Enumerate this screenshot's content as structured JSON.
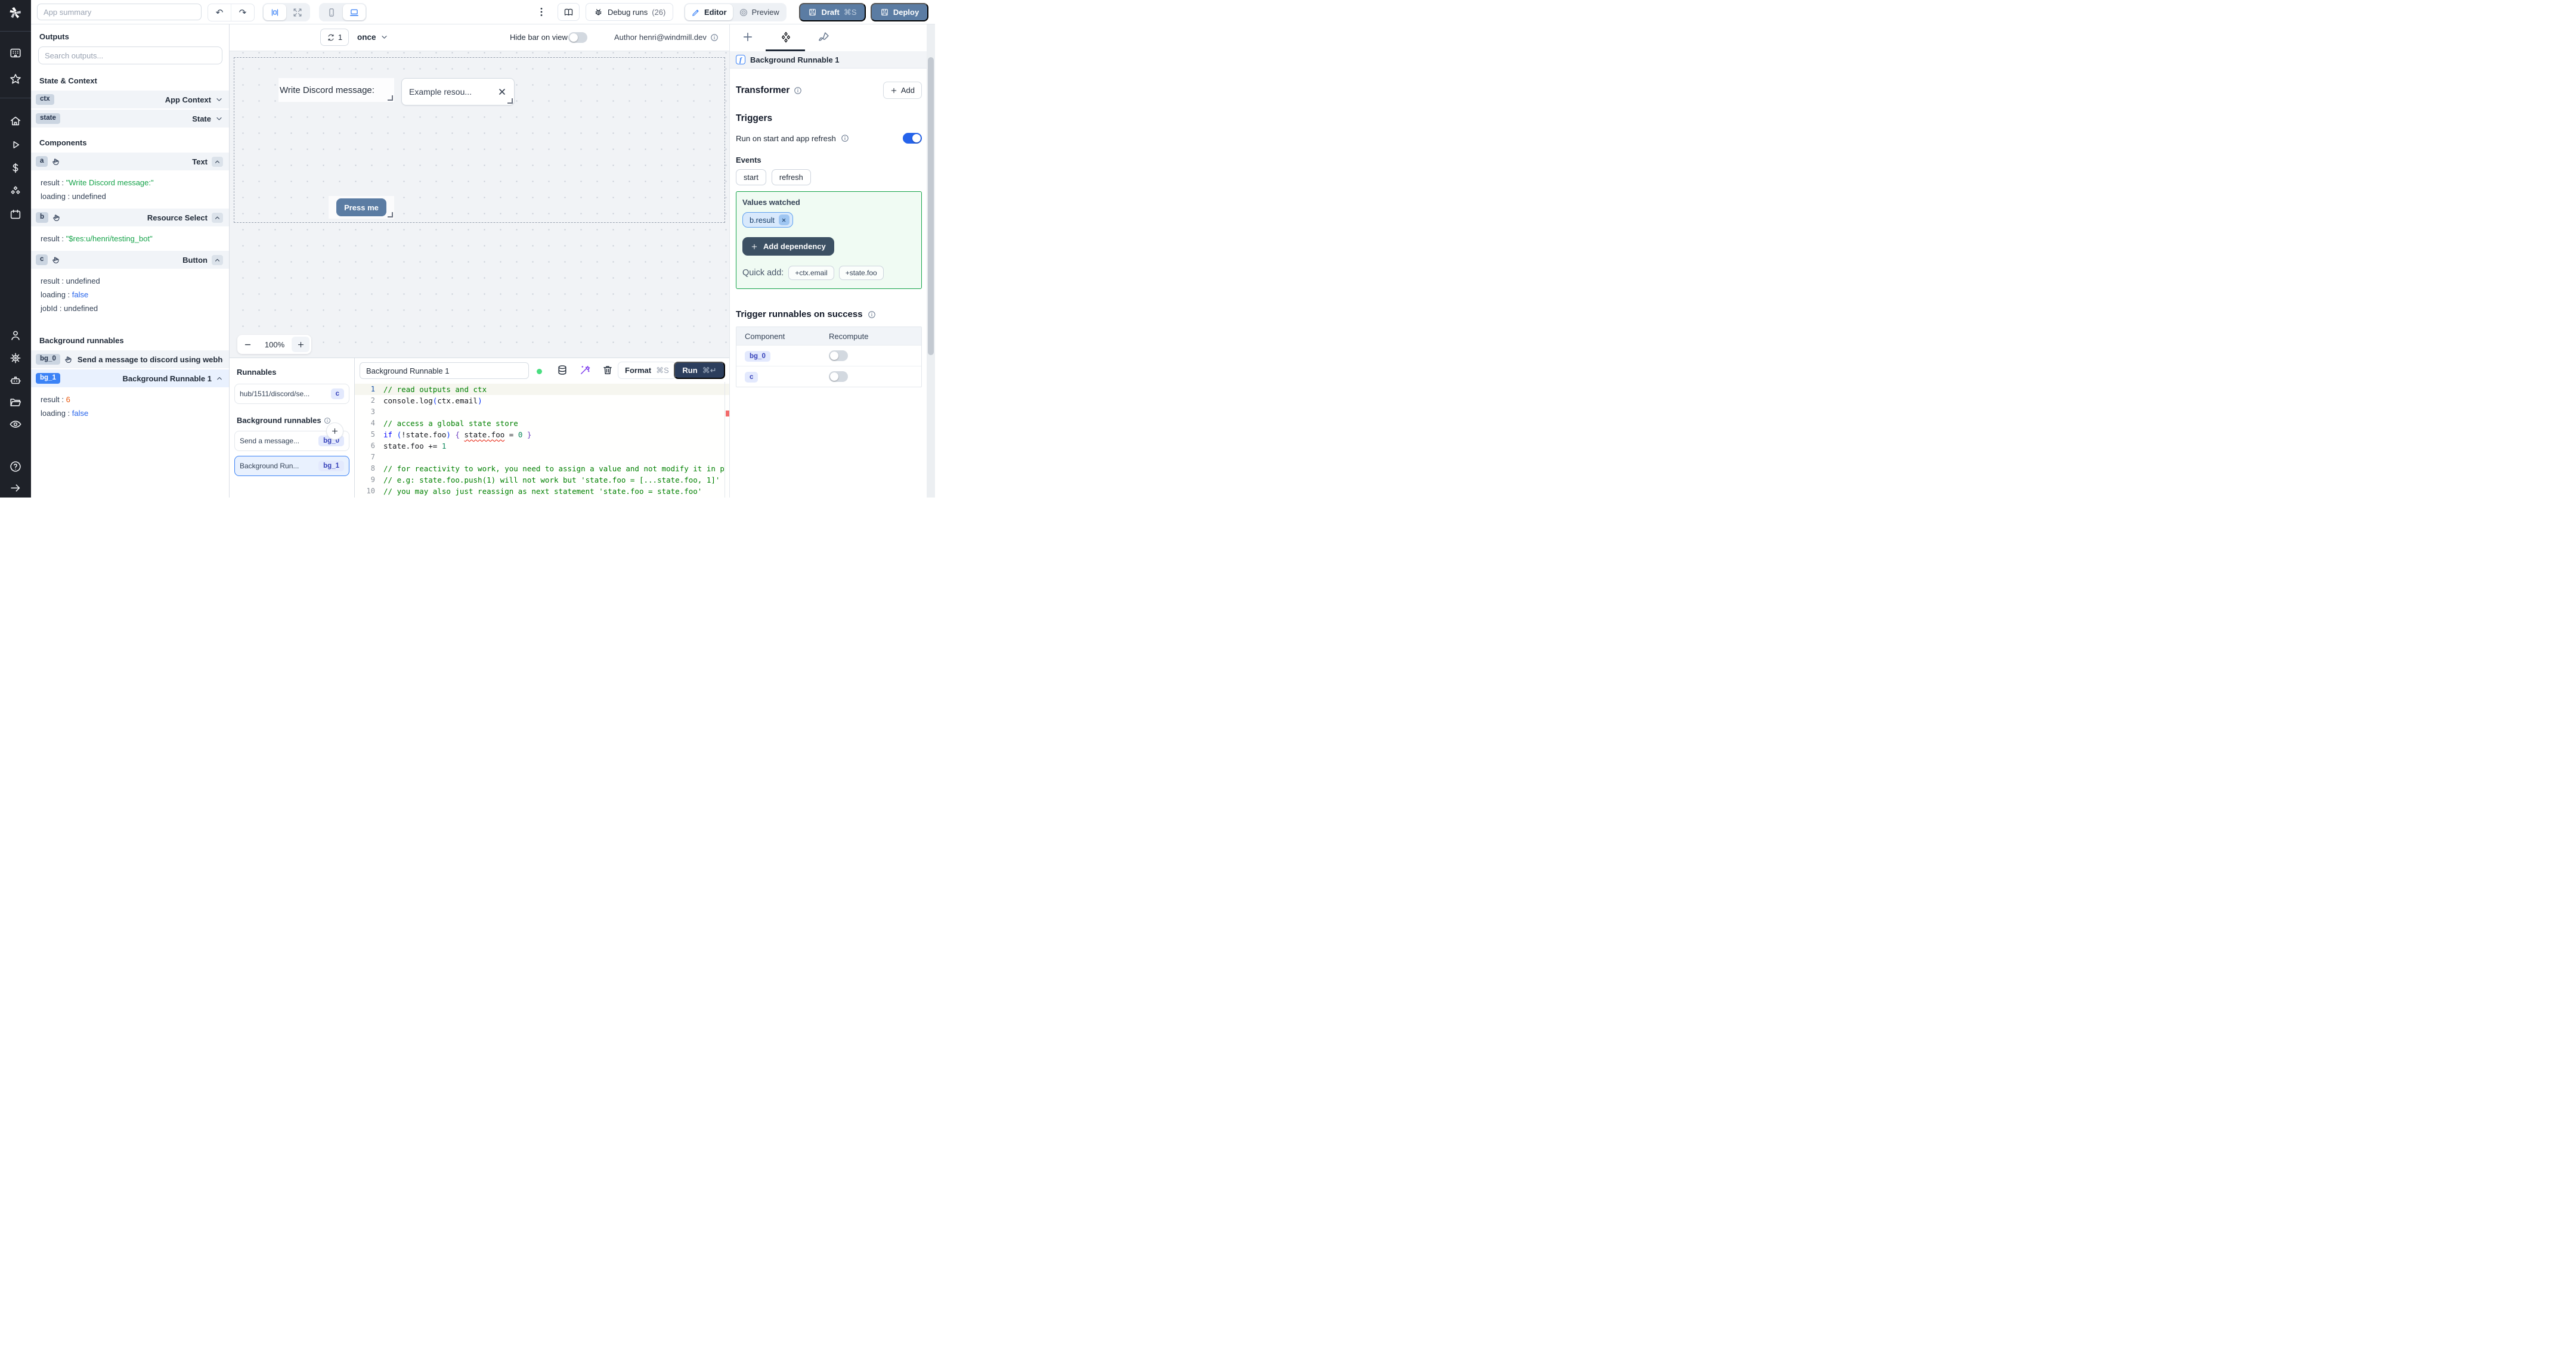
{
  "topbar": {
    "app_summary_placeholder": "App summary",
    "debug_label": "Debug runs",
    "debug_count": "(26)",
    "editor_label": "Editor",
    "preview_label": "Preview",
    "draft_label": "Draft",
    "draft_shortcut": "⌘S",
    "deploy_label": "Deploy"
  },
  "sidebar": {
    "groups": [
      [
        "keypad",
        "star"
      ],
      [
        "home",
        "play",
        "dollar",
        "cubes",
        "calendar"
      ],
      [
        "user",
        "gear",
        "robot",
        "folder",
        "eye"
      ],
      [
        "help",
        "arrow-right"
      ]
    ]
  },
  "outputs_panel": {
    "title": "Outputs",
    "search_placeholder": "Search outputs...",
    "state_context_title": "State & Context",
    "ctx_badge": "ctx",
    "ctx_label": "App Context",
    "state_badge": "state",
    "state_label": "State",
    "components_title": "Components",
    "comp_a": {
      "badge": "a",
      "type": "Text",
      "p1_key": "result",
      "p1_val": "\"Write Discord message:\"",
      "p2_key": "loading",
      "p2_val": "undefined"
    },
    "comp_b": {
      "badge": "b",
      "type": "Resource Select",
      "p1_key": "result",
      "p1_val": "\"$res:u/henri/testing_bot\""
    },
    "comp_c": {
      "badge": "c",
      "type": "Button",
      "p1_key": "result",
      "p1_val": "undefined",
      "p2_key": "loading",
      "p2_val": "false",
      "p3_key": "jobId",
      "p3_val": "undefined"
    },
    "background_title": "Background runnables",
    "bg0_badge": "bg_0",
    "bg0_label": "Send a message to discord using webhoo",
    "bg1_badge": "bg_1",
    "bg1_label": "Background Runnable 1",
    "bg1_p1_key": "result",
    "bg1_p1_val": "6",
    "bg1_p2_key": "loading",
    "bg1_p2_val": "false"
  },
  "canvas": {
    "refresh_count": "1",
    "frequency": "once",
    "hide_bar_label": "Hide bar on view",
    "author_label": "Author henri@windmill.dev",
    "text_component": "Write Discord message:",
    "select_value": "Example resou...",
    "button_label": "Press me",
    "zoom_level": "100%"
  },
  "runnables_panel": {
    "title": "Runnables",
    "hub_label": "hub/1511/discord/se...",
    "hub_badge": "c",
    "background_title": "Background runnables",
    "item0_label": "Send a message...",
    "item0_badge": "bg_0",
    "item1_label": "Background Run...",
    "item1_badge": "bg_1"
  },
  "editor": {
    "name_value": "Background Runnable 1",
    "format_label": "Format",
    "format_shortcut": "⌘S",
    "run_label": "Run",
    "run_shortcut": "⌘↵",
    "code_lines": [
      {
        "segments": [
          [
            "c",
            "// read outputs and ctx"
          ]
        ]
      },
      {
        "segments": [
          [
            "t",
            "console.log"
          ],
          [
            "p",
            "("
          ],
          [
            "t",
            "ctx.email"
          ],
          [
            "p",
            ")"
          ]
        ]
      },
      {
        "segments": []
      },
      {
        "segments": [
          [
            "c",
            "// access a global state store"
          ]
        ]
      },
      {
        "segments": [
          [
            "k",
            "if"
          ],
          [
            "t",
            " "
          ],
          [
            "p",
            "("
          ],
          [
            "t",
            "!state.foo"
          ],
          [
            "p",
            ")"
          ],
          [
            "t",
            " "
          ],
          [
            "b",
            "{"
          ],
          [
            "t",
            " "
          ],
          [
            "e",
            "state.foo"
          ],
          [
            "t",
            " = "
          ],
          [
            "n",
            "0"
          ],
          [
            "t",
            " "
          ],
          [
            "b",
            "}"
          ]
        ]
      },
      {
        "segments": [
          [
            "t",
            "state.foo += "
          ],
          [
            "n",
            "1"
          ]
        ]
      },
      {
        "segments": []
      },
      {
        "segments": [
          [
            "c",
            "// for reactivity to work, you need to assign a value and not modify it in p"
          ]
        ]
      },
      {
        "segments": [
          [
            "c",
            "// e.g: state.foo.push(1) will not work but 'state.foo = [...state.foo, 1]'"
          ]
        ]
      },
      {
        "segments": [
          [
            "c",
            "// you may also just reassign as next statement 'state.foo = state.foo'"
          ]
        ]
      }
    ]
  },
  "settings_panel": {
    "header": "Background Runnable 1",
    "transformer_label": "Transformer",
    "add_label": "Add",
    "triggers_title": "Triggers",
    "run_on_start_label": "Run on start and app refresh",
    "events_label": "Events",
    "event_chip_0": "start",
    "event_chip_1": "refresh",
    "values_watched_title": "Values watched",
    "watched_chip": "b.result",
    "add_dependency_label": "Add dependency",
    "quick_add_label": "Quick add:",
    "quick_chip_0": "+ctx.email",
    "quick_chip_1": "+state.foo",
    "trigger_success_title": "Trigger runnables on success",
    "col_component": "Component",
    "col_recompute": "Recompute",
    "row0_badge": "bg_0",
    "row1_badge": "c"
  }
}
